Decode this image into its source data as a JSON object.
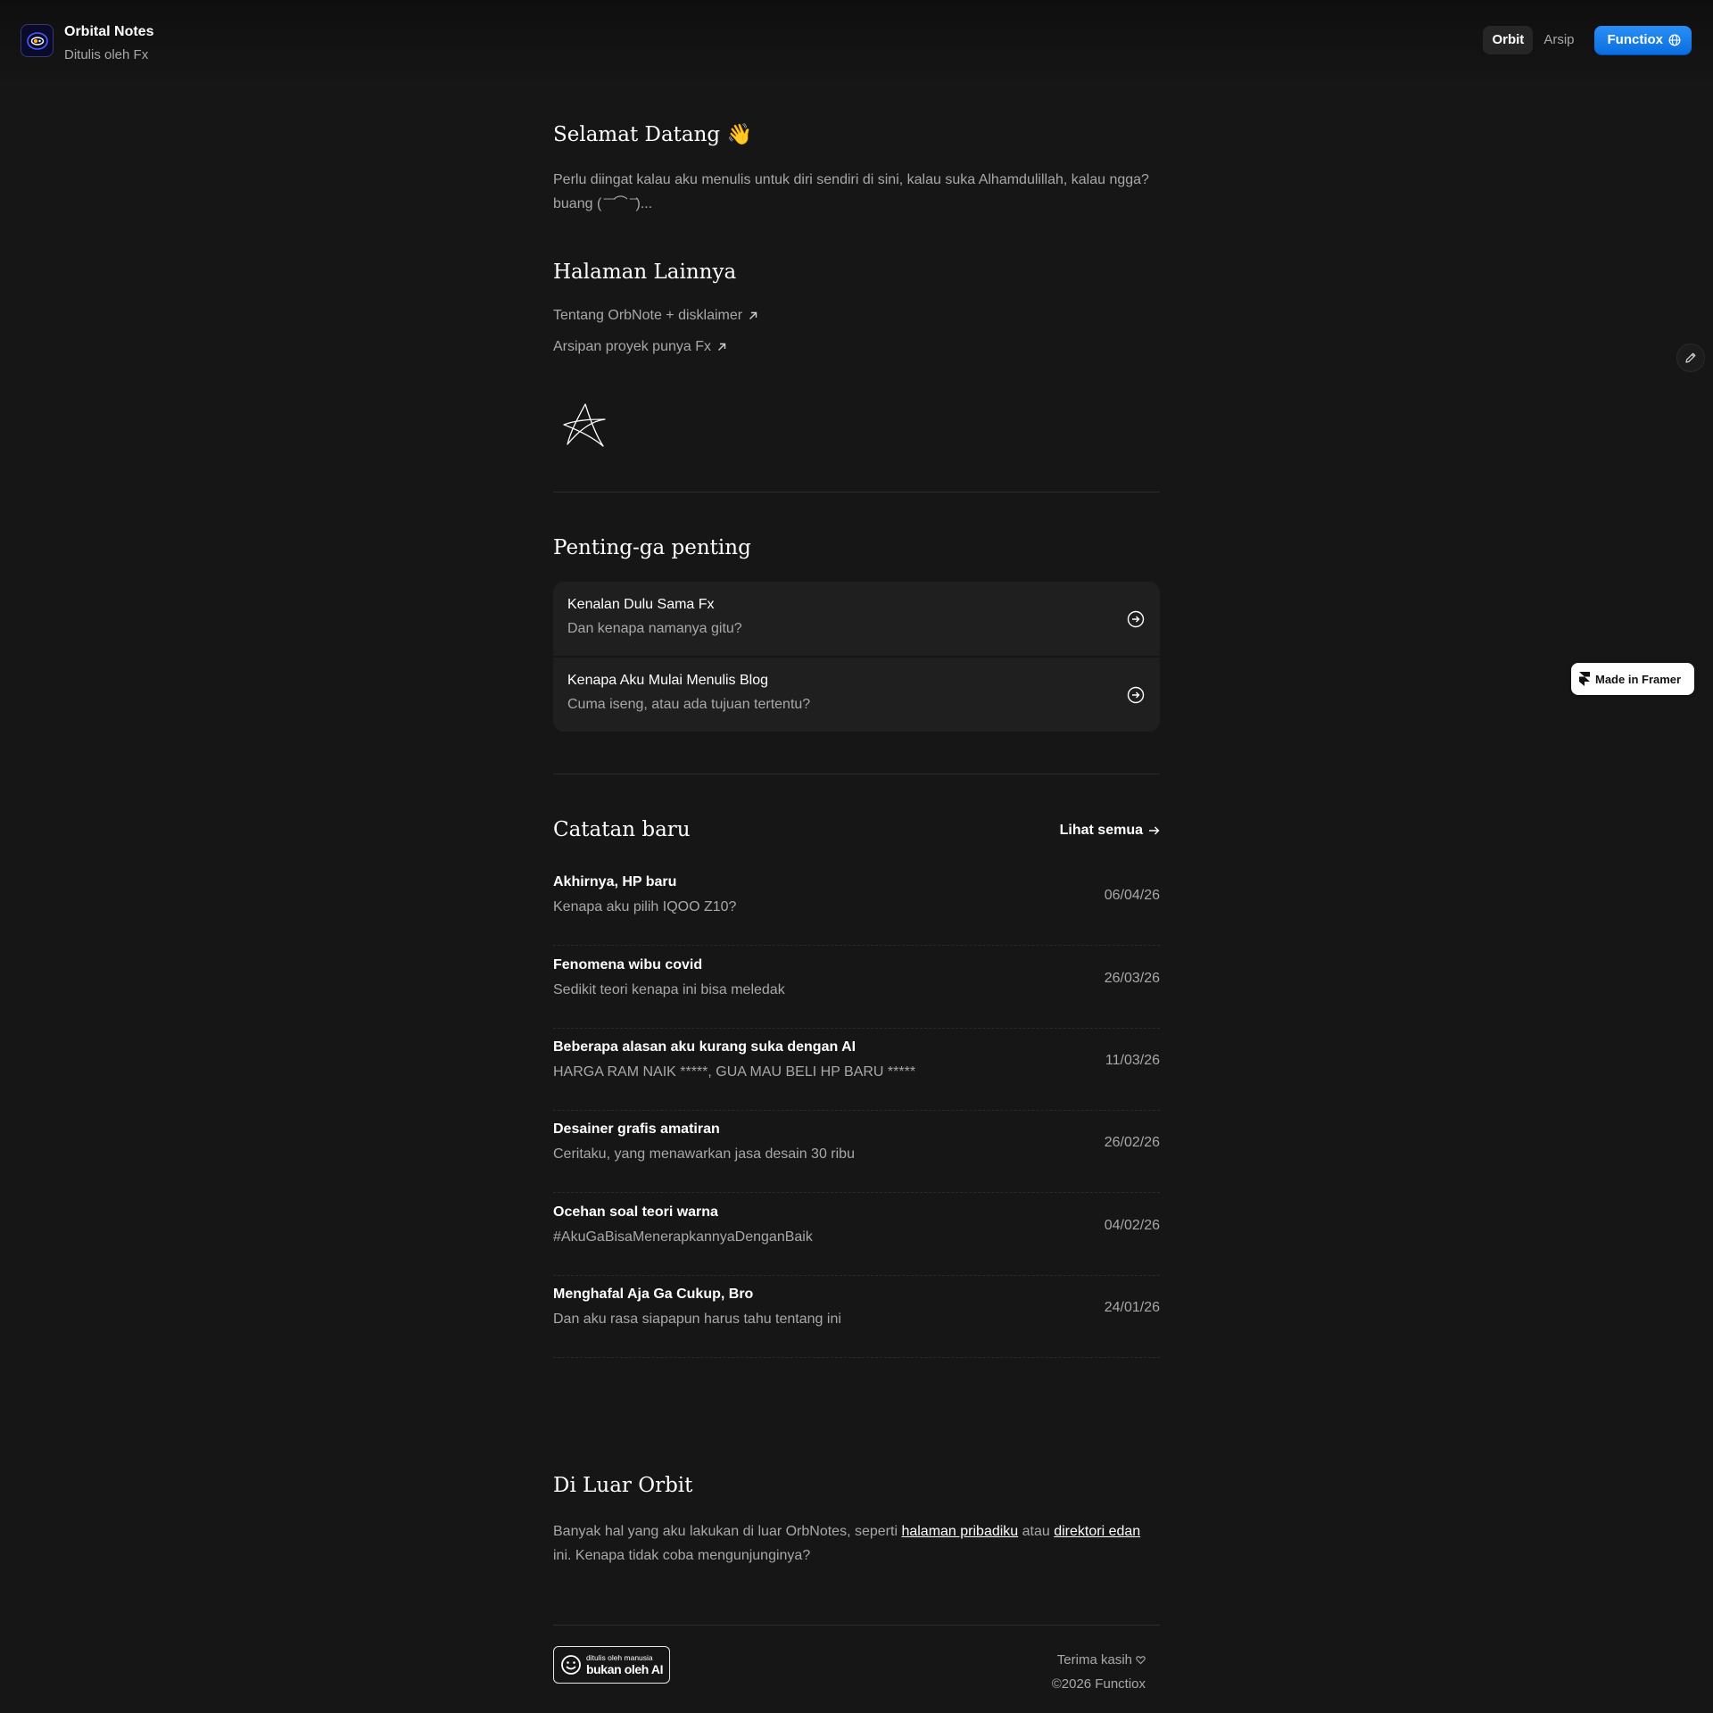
{
  "header": {
    "title": "Orbital Notes",
    "subtitle": "Ditulis oleh Fx",
    "logo_icon": "orbit-eye-icon",
    "nav": {
      "tabs": [
        {
          "label": "Orbit",
          "active": true
        },
        {
          "label": "Arsip",
          "active": false
        }
      ],
      "button_label": "Functiox",
      "button_icon": "globe-icon"
    }
  },
  "welcome": {
    "title": "Selamat Datang 👋",
    "text": "Perlu diingat kalau aku menulis untuk diri sendiri di sini, kalau suka Alhamdulillah, kalau ngga? buang ( ̄ ̄ ̄⌒ ̄ ̄)..."
  },
  "other_pages": {
    "title": "Halaman Lainnya",
    "links": [
      {
        "label": "Tentang OrbNote + disklaimer"
      },
      {
        "label": "Arsipan proyek punya Fx"
      }
    ]
  },
  "important": {
    "title": "Penting-ga penting",
    "cards": [
      {
        "title": "Kenalan Dulu Sama Fx",
        "subtitle": "Dan kenapa namanya gitu?"
      },
      {
        "title": "Kenapa Aku Mulai Menulis Blog",
        "subtitle": "Cuma iseng, atau ada tujuan tertentu?"
      }
    ]
  },
  "notes": {
    "title": "Catatan baru",
    "see_all": "Lihat semua",
    "items": [
      {
        "title": "Akhirnya, HP baru",
        "subtitle": "Kenapa aku pilih IQOO Z10?",
        "date": "06/04/26"
      },
      {
        "title": "Fenomena wibu covid",
        "subtitle": "Sedikit teori kenapa ini bisa meledak",
        "date": "26/03/26"
      },
      {
        "title": "Beberapa alasan aku kurang suka dengan AI",
        "subtitle": "HARGA RAM NAIK *****, GUA MAU BELI HP BARU *****",
        "date": "11/03/26"
      },
      {
        "title": "Desainer grafis amatiran",
        "subtitle": "Ceritaku, yang menawarkan jasa desain 30 ribu",
        "date": "26/02/26"
      },
      {
        "title": "Ocehan soal teori warna",
        "subtitle": "#AkuGaBisaMenerapkannyaDenganBaik",
        "date": "04/02/26"
      },
      {
        "title": "Menghafal Aja Ga Cukup, Bro",
        "subtitle": "Dan aku rasa siapapun harus tahu tentang ini",
        "date": "24/01/26"
      }
    ]
  },
  "outside": {
    "title": "Di Luar Orbit",
    "text_before": "Banyak hal yang aku lakukan di luar OrbNotes, seperti ",
    "link1": "halaman pribadiku",
    "text_mid": " atau ",
    "link2": "direktori edan",
    "text_after": " ini. Kenapa tidak coba mengunjunginya?"
  },
  "footer": {
    "badge_small": "ditulis oleh manusia",
    "badge_big": "bukan oleh AI",
    "thanks": "Terima kasih",
    "copyright": "©2026 Functiox"
  },
  "framer_badge": "Made in Framer",
  "colors": {
    "background": "#161616",
    "accent_button": "#1a7ff0",
    "text_primary": "#ffffff",
    "text_muted": "#a8a8a8"
  }
}
